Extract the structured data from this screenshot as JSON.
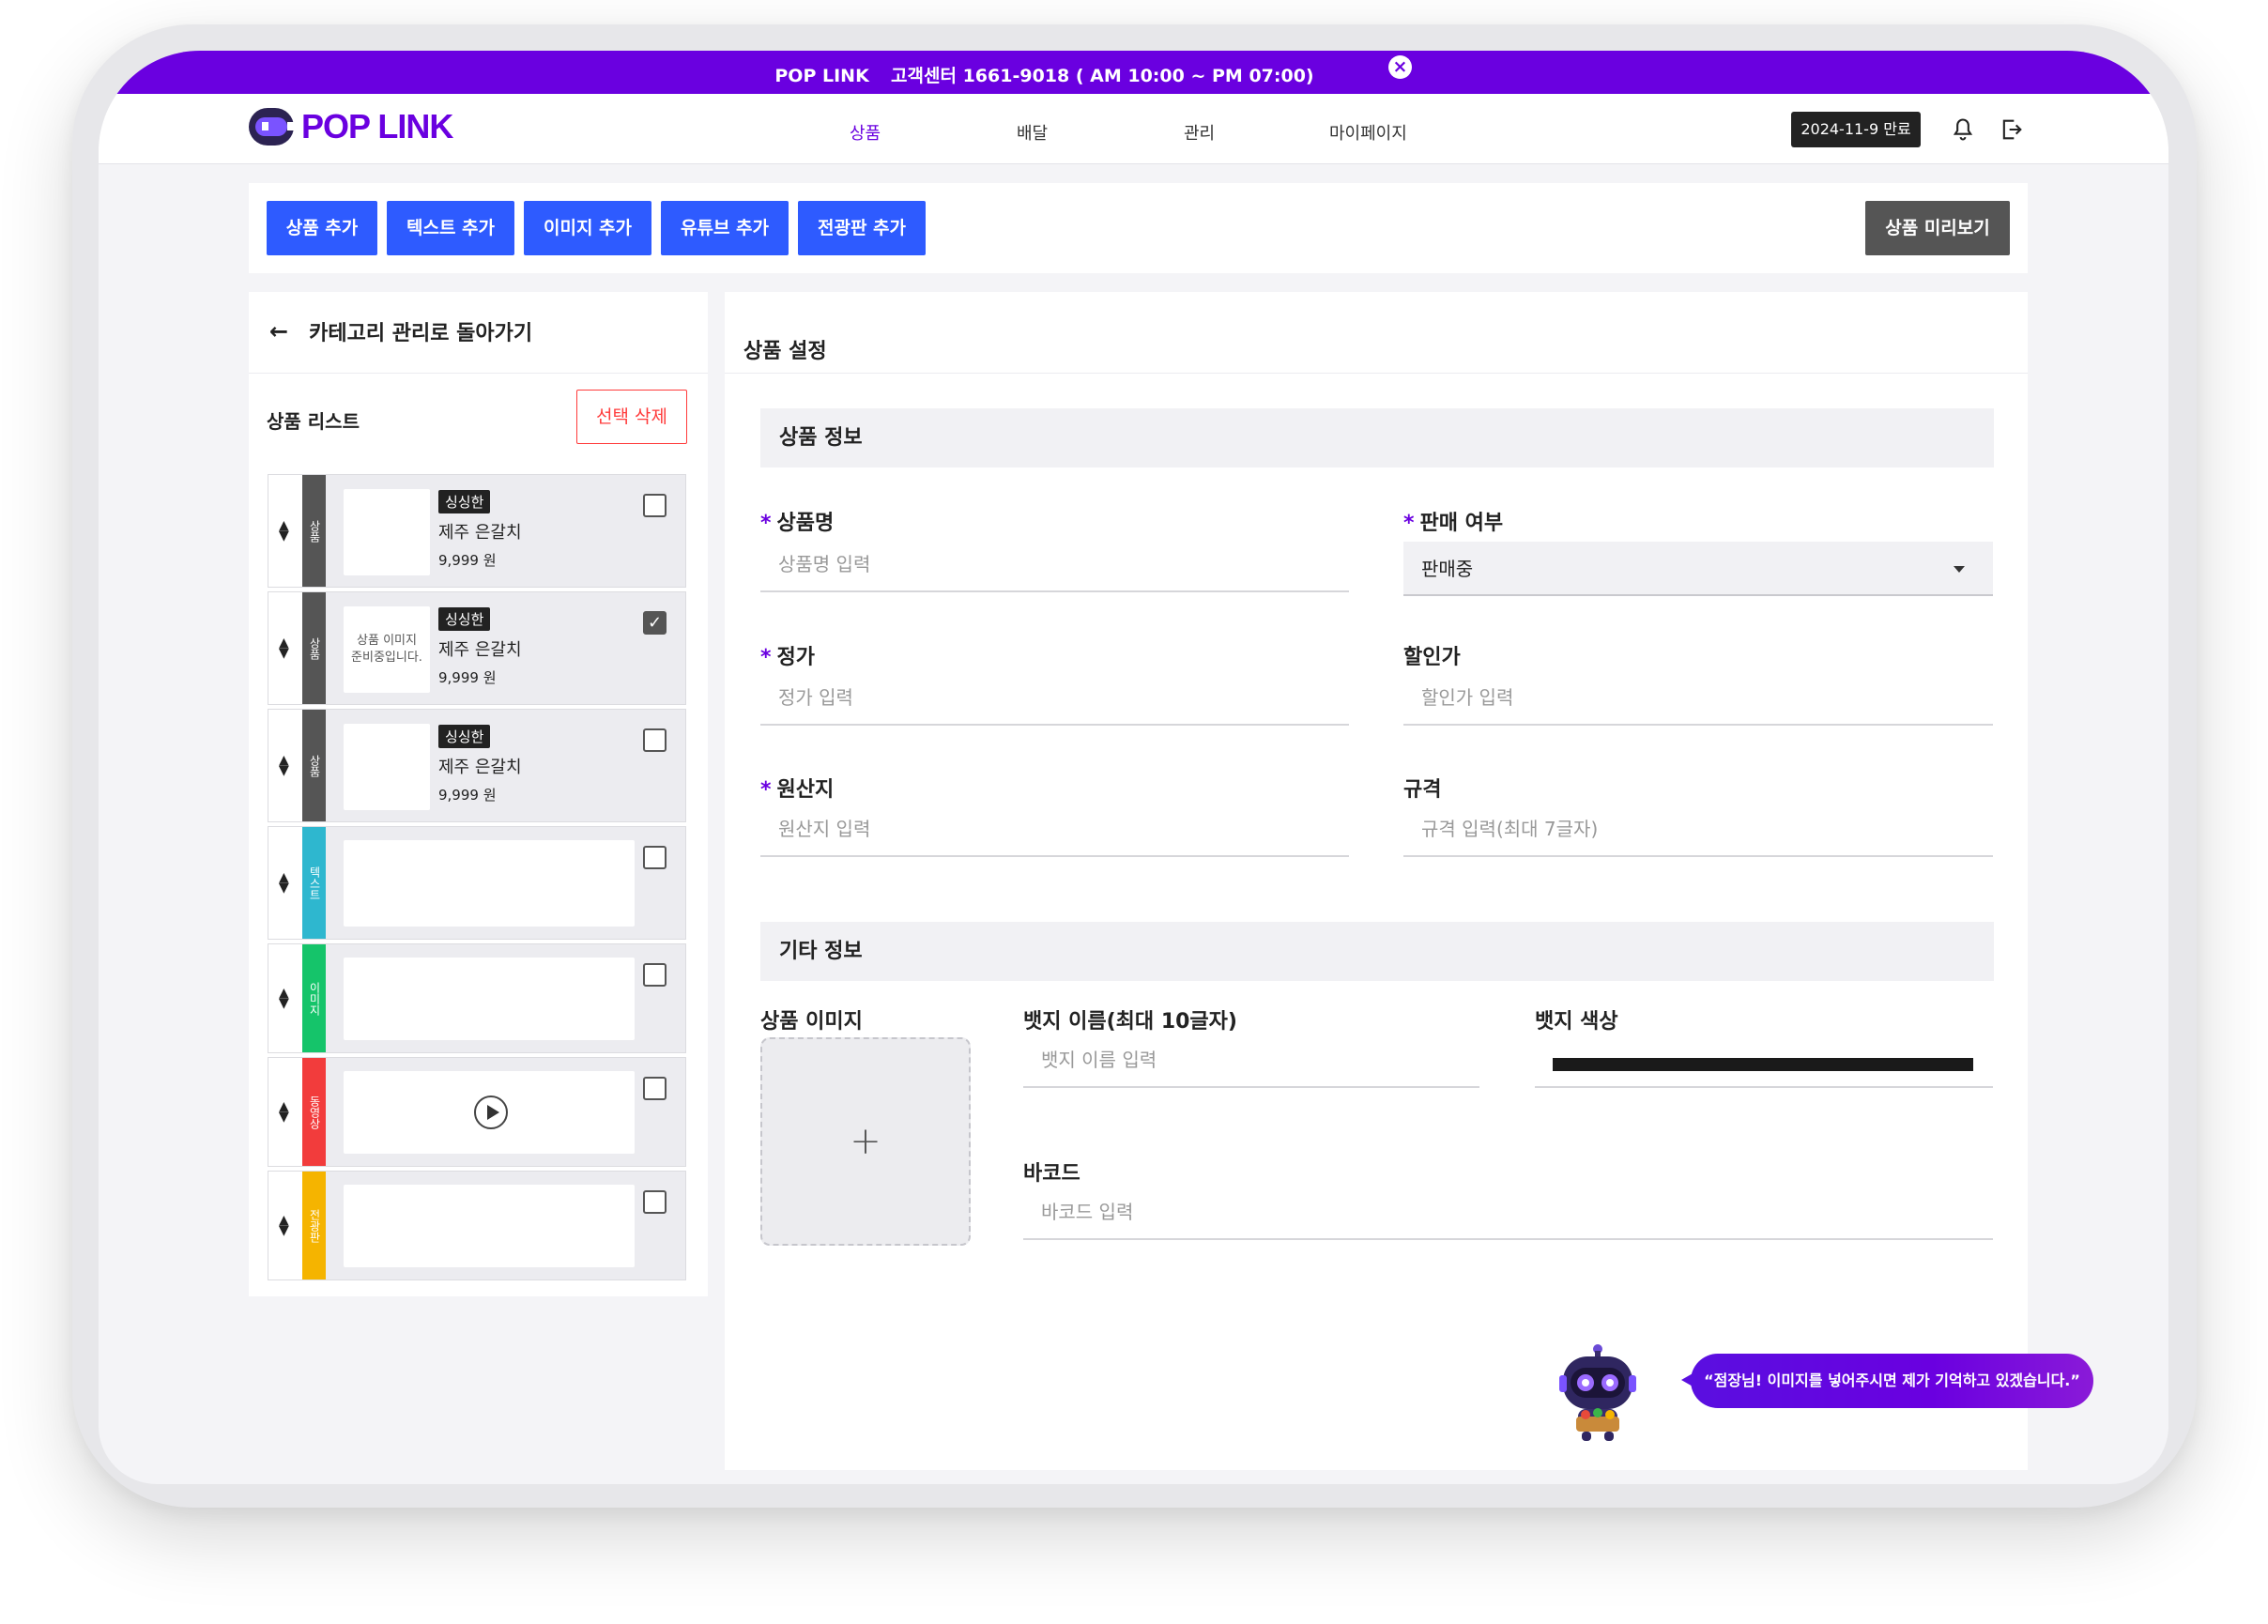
{
  "announcement": {
    "brand": "POP LINK",
    "text": "고객센터 1661-9018 ( AM 10:00 ~ PM 07:00)"
  },
  "header": {
    "logo": "POP LINK",
    "nav": [
      "상품",
      "배달",
      "관리",
      "마이페이지"
    ],
    "active_nav": "상품",
    "expire_badge": "2024-11-9 만료"
  },
  "toolbar": {
    "buttons": [
      "상품 추가",
      "텍스트 추가",
      "이미지 추가",
      "유튜브 추가",
      "전광판 추가"
    ],
    "preview": "상품 미리보기"
  },
  "left": {
    "back": "카테고리 관리로 돌아가기",
    "list_title": "상품 리스트",
    "delete_selected": "선택 삭제",
    "items": [
      {
        "type": "상품",
        "badge": "싱싱한",
        "name": "제주 은갈치",
        "price": "9,999 원",
        "checked": false,
        "thumb": ""
      },
      {
        "type": "상품",
        "badge": "싱싱한",
        "name": "제주 은갈치",
        "price": "9,999 원",
        "checked": true,
        "thumb": "상품 이미지 준비중입니다."
      },
      {
        "type": "상품",
        "badge": "싱싱한",
        "name": "제주 은갈치",
        "price": "9,999 원",
        "checked": false,
        "thumb": ""
      },
      {
        "type": "텍스트",
        "checked": false
      },
      {
        "type": "이미지",
        "checked": false
      },
      {
        "type": "동영상",
        "checked": false
      },
      {
        "type": "전광판",
        "checked": false
      }
    ]
  },
  "right": {
    "title": "상품 설정",
    "section_info": "상품 정보",
    "fields": {
      "name": {
        "label": "상품명",
        "placeholder": "상품명 입력"
      },
      "sale": {
        "label": "판매 여부",
        "value": "판매중"
      },
      "price": {
        "label": "정가",
        "placeholder": "정가 입력"
      },
      "discount": {
        "label": "할인가",
        "placeholder": "할인가 입력"
      },
      "origin": {
        "label": "원산지",
        "placeholder": "원산지 입력"
      },
      "spec": {
        "label": "규격",
        "placeholder": "규격 입력(최대 7글자)"
      }
    },
    "section_etc": "기타 정보",
    "image_label": "상품 이미지",
    "upload_plus": "+",
    "badge_name": {
      "label": "뱃지 이름(최대 10글자)",
      "placeholder": "뱃지 이름 입력"
    },
    "badge_color": {
      "label": "뱃지 색상",
      "value": "#1a1a1a"
    },
    "barcode": {
      "label": "바코드",
      "placeholder": "바코드 입력"
    },
    "assistant_message": "“점장님! 이미지를 넣어주시면 제가 기억하고 있겠습니다.”"
  },
  "colors": {
    "brand": "#6a00e0",
    "primary_button": "#2e5bff",
    "danger": "#ff3b3b",
    "type_product": "#555555",
    "type_text": "#2eb7cf",
    "type_image": "#15c46a",
    "type_video": "#f23c3c",
    "type_board": "#f5b400"
  },
  "icons": [
    "close-icon",
    "bell-icon",
    "logout-icon",
    "back-arrow-icon",
    "drag-handle-icon",
    "checkbox-icon",
    "play-icon",
    "caret-down-icon",
    "plus-icon",
    "robot-mascot-icon"
  ]
}
